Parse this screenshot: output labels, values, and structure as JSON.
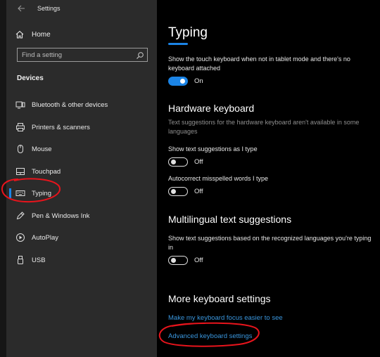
{
  "window": {
    "title": "Settings"
  },
  "sidebar": {
    "home_label": "Home",
    "search_placeholder": "Find a setting",
    "section_header": "Devices",
    "items": [
      {
        "label": "Bluetooth & other devices",
        "icon": "bluetooth-devices-icon"
      },
      {
        "label": "Printers & scanners",
        "icon": "printer-icon"
      },
      {
        "label": "Mouse",
        "icon": "mouse-icon"
      },
      {
        "label": "Touchpad",
        "icon": "touchpad-icon"
      },
      {
        "label": "Typing",
        "icon": "keyboard-icon",
        "selected": true
      },
      {
        "label": "Pen & Windows Ink",
        "icon": "pen-icon"
      },
      {
        "label": "AutoPlay",
        "icon": "autoplay-icon"
      },
      {
        "label": "USB",
        "icon": "usb-icon"
      }
    ]
  },
  "main": {
    "title": "Typing",
    "touch_keyboard_text": "Show the touch keyboard when not in tablet mode and there's no keyboard attached",
    "touch_keyboard_toggle": "On",
    "hardware_header": "Hardware keyboard",
    "hardware_note": "Text suggestions for the hardware keyboard aren't available in some languages",
    "show_suggestions_label": "Show text suggestions as I type",
    "show_suggestions_toggle": "Off",
    "autocorrect_label": "Autocorrect misspelled words I type",
    "autocorrect_toggle": "Off",
    "multilingual_header": "Multilingual text suggestions",
    "multilingual_text": "Show text suggestions based on the recognized languages you're typing in",
    "multilingual_toggle": "Off",
    "more_header": "More keyboard settings",
    "link_focus": "Make my keyboard focus easier to see",
    "link_advanced": "Advanced keyboard settings"
  },
  "colors": {
    "accent": "#1b84e6",
    "link": "#3a96dd",
    "annotation": "#e8141c",
    "sidebar_bg": "#2b2b2b",
    "main_bg": "#000000"
  }
}
